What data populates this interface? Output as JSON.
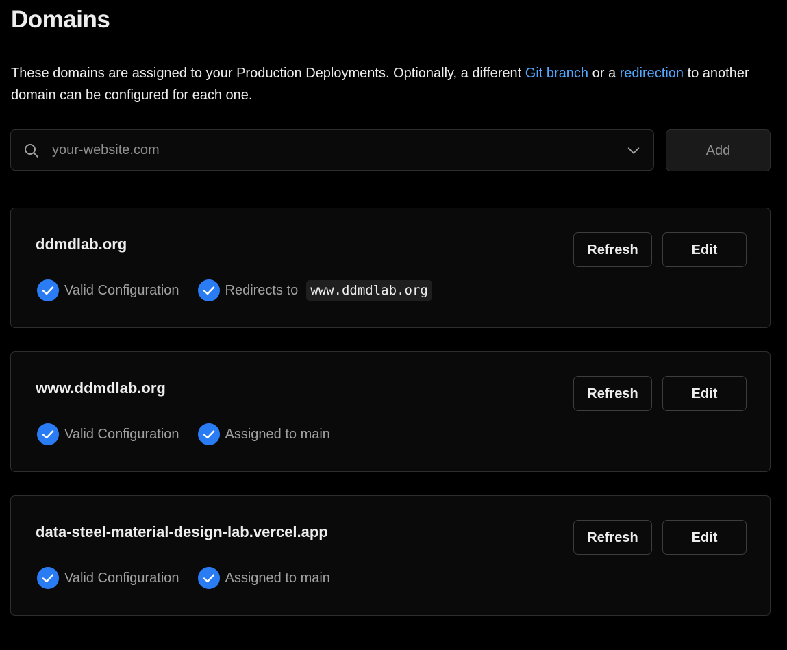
{
  "page": {
    "title": "Domains",
    "description": {
      "before": "These domains are assigned to your Production Deployments. Optionally, a different ",
      "link1": "Git branch",
      "middle": " or a ",
      "link2": "redirection",
      "after": " to another domain can be configured for each one."
    }
  },
  "search": {
    "placeholder": "your-website.com",
    "value": "",
    "icon": "search-icon",
    "dropdown_icon": "chevron-down-icon"
  },
  "add_button": {
    "label": "Add"
  },
  "domains": [
    {
      "name": "ddmdlab.org",
      "status": "Valid Configuration",
      "detail_label": "Redirects to",
      "detail_value": "www.ddmdlab.org",
      "refresh_label": "Refresh",
      "edit_label": "Edit"
    },
    {
      "name": "www.ddmdlab.org",
      "status": "Valid Configuration",
      "detail_label": "Assigned to main",
      "refresh_label": "Refresh",
      "edit_label": "Edit"
    },
    {
      "name": "data-steel-material-design-lab.vercel.app",
      "status": "Valid Configuration",
      "detail_label": "Assigned to main",
      "refresh_label": "Refresh",
      "edit_label": "Edit"
    }
  ],
  "colors": {
    "background": "#000000",
    "card": "#0a0a0a",
    "border": "#2e2e2e",
    "link": "#52a8ff",
    "check": "#2a7cf5",
    "text": "#ededed",
    "muted": "#a1a1a1"
  }
}
